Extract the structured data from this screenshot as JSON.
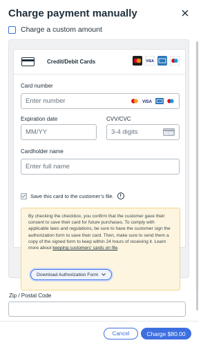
{
  "header": {
    "title": "Charge payment manually"
  },
  "custom_amount": {
    "label": "Charge a custom amount",
    "checked": false
  },
  "payment_method": {
    "title": "Credit/Debit Cards",
    "brands": [
      "mastercard-icon",
      "visa-icon",
      "amex-icon",
      "maestro-icon"
    ]
  },
  "card_number": {
    "label": "Card number",
    "placeholder": "Enter number"
  },
  "expiration": {
    "label": "Expiration date",
    "placeholder": "MM/YY"
  },
  "cvv": {
    "label": "CVV/CVC",
    "placeholder": "3-4 digits"
  },
  "cardholder": {
    "label": "Cardholder name",
    "placeholder": "Enter full name"
  },
  "save_card": {
    "label": "Save this card to the customer’s file.",
    "checked": true
  },
  "notice": {
    "text": "By checking the checkbox, you confirm that the customer gave their consent to save their card for future purchases. To comply with applicable laws and regulations, be sure to have the customer sign the authorization form to save their card. Then, make sure to send them a copy of the signed form to keep within 24 hours of receiving it. Learn more about ",
    "link": "keeping customers' cards on file",
    "end": ".",
    "button": "Download Authorization Form"
  },
  "zip": {
    "label": "Zip / Postal Code",
    "placeholder": ""
  },
  "footer": {
    "cancel": "Cancel",
    "charge": "Charge $80.00"
  },
  "colors": {
    "accent": "#3d6fe0",
    "notice_bg": "#fdf5df",
    "notice_border": "#f3d58e"
  }
}
